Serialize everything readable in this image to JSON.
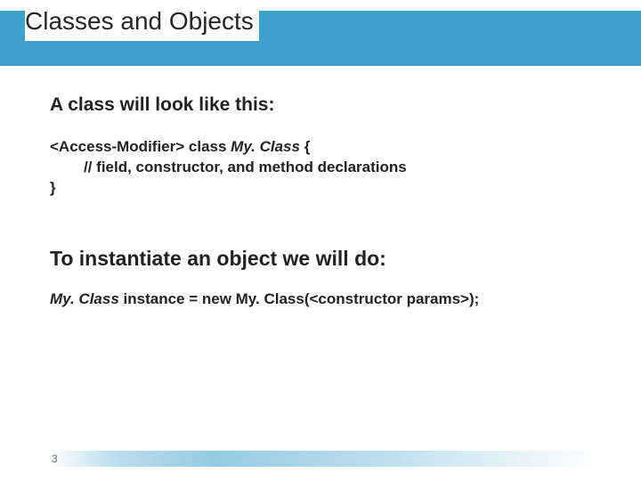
{
  "title": "Classes and Objects",
  "intro": "A class will look like this:",
  "code": {
    "line1_prefix": "<Access-Modifier> class ",
    "line1_class": "My. Class",
    "line1_suffix": " {",
    "line2": "// field, constructor, and method declarations",
    "line3": "}"
  },
  "instantiate_heading": "To instantiate an object we will do:",
  "instantiate": {
    "class": "My. Class",
    "rest": " instance = new My. Class(<constructor params>);"
  },
  "page_number": "3"
}
